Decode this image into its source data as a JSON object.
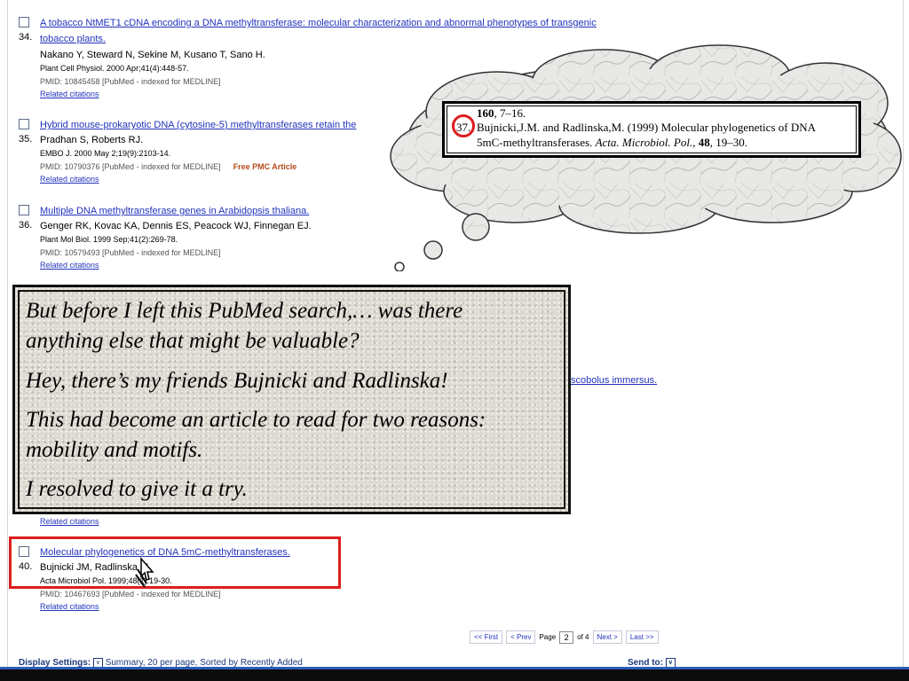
{
  "results": [
    {
      "number": "34.",
      "title_line1": "A tobacco NtMET1 cDNA encoding a DNA methyltransferase: molecular characterization and abnormal phenotypes of transgenic",
      "title_line2": "tobacco plants.",
      "authors": "Nakano Y, Steward N, Sekine M, Kusano T, Sano H.",
      "journal": "Plant Cell Physiol. 2000 Apr;41(4):448-57.",
      "pmid": "PMID: 10845458 [PubMed - indexed for MEDLINE]",
      "related": "Related citations"
    },
    {
      "number": "35.",
      "title": "Hybrid mouse-prokaryotic DNA (cytosine-5) methyltransferases retain the",
      "authors": "Pradhan S, Roberts RJ.",
      "journal": "EMBO J. 2000 May 2;19(9):2103-14.",
      "pmid": "PMID: 10790376 [PubMed - indexed for MEDLINE]",
      "free": "Free PMC Article",
      "related": "Related citations"
    },
    {
      "number": "36.",
      "title": "Multiple DNA methyltransferase genes in Arabidopsis thaliana.",
      "authors": "Genger RK, Kovac KA, Dennis ES, Peacock WJ, Finnegan EJ.",
      "journal": "Plant Mol Biol. 1999 Sep;41(2):269-78.",
      "pmid": "PMID: 10579493 [PubMed - indexed for MEDLINE]",
      "related": "Related citations"
    }
  ],
  "hidden_fragment": "scobolus immersus.",
  "result39_related": "Related citations",
  "result40": {
    "number": "40.",
    "title": "Molecular phylogenetics of DNA 5mC-methyltransferases.",
    "authors": "Bujnicki JM, Radlinska M.",
    "journal": "Acta Microbiol Pol. 1999;48(1):19-30.",
    "pmid": "PMID: 10467693 [PubMed - indexed for MEDLINE]",
    "related": "Related citations"
  },
  "pager": {
    "first": "<< First",
    "prev": "< Prev",
    "page_label": "Page",
    "page_value": "2",
    "of": "of 4",
    "next": "Next >",
    "last": "Last >>"
  },
  "footer": {
    "display_label": "Display Settings:",
    "display_value": "Summary, 20 per page, Sorted by Recently Added",
    "send_to": "Send to:"
  },
  "thought_bubble": {
    "line1_prefix": "160",
    "line1_suffix": ", 7–16.",
    "ref_number": "37.",
    "line2": "Bujnicki,J.M. and Radlinska,M. (1999) Molecular phylogenetics of DNA",
    "line3_prefix": "5mC-methyltransferases. ",
    "line3_journal": "Acta. Microbiol. Pol.",
    "line3_sep": ", ",
    "line3_volume": "48",
    "line3_pages": ", 19–30."
  },
  "callout": {
    "line1": "But before I left this PubMed search,… was there",
    "line2": "anything else that might be valuable?",
    "line3": "Hey, there’s my friends Bujnicki and Radlinska!",
    "line4": "This had become an article to read for two reasons:",
    "line5": "mobility and motifs.",
    "line6": "I resolved to give it a try."
  }
}
